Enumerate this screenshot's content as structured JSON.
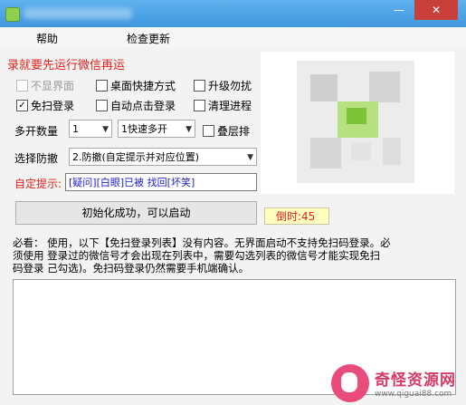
{
  "window": {
    "minimize_glyph": "—",
    "close_glyph": "✕"
  },
  "menu": {
    "help_label": "帮助",
    "update_label": "检查更新"
  },
  "warning": "录就要先运行微信再运",
  "options": {
    "no_ui": "不显界面",
    "desktop_shortcut": "桌面快捷方式",
    "upgrade_no_disturb": "升级勿扰",
    "scan_free_login": "免扫登录",
    "auto_click_login": "自动点击登录",
    "clean_process": "清理进程",
    "stack_label": "叠层排"
  },
  "multi": {
    "label": "多开数量",
    "count_value": "1",
    "mode_value": "1快速多开"
  },
  "anti_recall": {
    "label": "选择防撤",
    "value": "2.防撤(自定提示并对应位置)"
  },
  "custom_prompt": {
    "label": "自定提示:",
    "value": "[疑问][白眼]已被        找回[坏笑]"
  },
  "init_button_label": "初始化成功，可以启动",
  "countdown_text": "倒时:45",
  "notice_lines": [
    "必看：  使用，以下【免扫登录列表】没有内容。无界面启动不支持免扫码登录。必",
    "须使用   登录过的微信号才会出现在列表中，需要勾选列表的微信号才能实现免扫",
    "码登录   己勾选)。免扫码登录仍然需要手机端确认。"
  ],
  "watermark": {
    "main": "奇怪资源网",
    "sub": "www.qiguai88.com"
  },
  "colors": {
    "titlebar": "#4aa3e8",
    "warning_red": "#e0221c",
    "prompt_blue": "#1a1ad0",
    "countdown_bg": "#ffffc0"
  }
}
